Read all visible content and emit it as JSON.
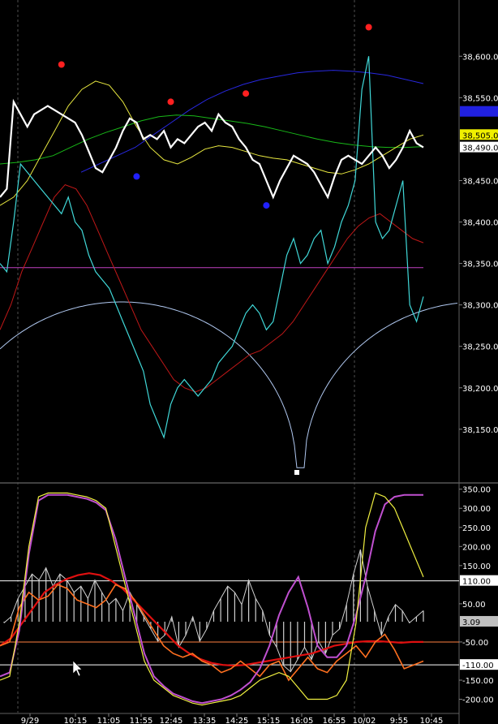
{
  "chart_data": [
    {
      "type": "line",
      "panel": "price",
      "y_ticks": [
        "38,600.0",
        "38,550.0",
        "38,505.0",
        "38,490.0",
        "38,450.0",
        "38,400.0",
        "38,350.0",
        "38,300.0",
        "38,250.0",
        "38,200.0",
        "38,150.0"
      ],
      "y_tick_values": [
        38600,
        38550,
        38505,
        38490,
        38450,
        38400,
        38350,
        38300,
        38250,
        38200,
        38150
      ],
      "ylim": [
        38095,
        38660
      ],
      "grid": false,
      "colors": {
        "price": "#ffffff",
        "cyan": "#40d8d8",
        "red": "#c01818",
        "yellow": "#e8e840",
        "green": "#18b818",
        "blue": "#2828e0",
        "magenta": "#c040c0",
        "arc": "#b0c8f0",
        "dot_red": "#ff2020",
        "dot_blue": "#2020ff"
      },
      "horizontal_line_value": 38345,
      "price_series": [
        38430,
        38440,
        38545,
        38530,
        38515,
        38530,
        38535,
        38540,
        38535,
        38530,
        38525,
        38520,
        38505,
        38485,
        38465,
        38460,
        38475,
        38490,
        38510,
        38525,
        38520,
        38500,
        38505,
        38500,
        38510,
        38490,
        38500,
        38495,
        38505,
        38515,
        38520,
        38510,
        38530,
        38520,
        38515,
        38500,
        38490,
        38475,
        38470,
        38450,
        38430,
        38450,
        38465,
        38480,
        38475,
        38470,
        38460,
        38445,
        38430,
        38455,
        38475,
        38480,
        38475,
        38470,
        38480,
        38490,
        38480,
        38465,
        38475,
        38490,
        38510,
        38495,
        38490
      ],
      "cyan_series": [
        38350,
        38340,
        38400,
        38470,
        38460,
        38450,
        38440,
        38430,
        38420,
        38410,
        38430,
        38400,
        38390,
        38360,
        38340,
        38330,
        38320,
        38300,
        38280,
        38260,
        38240,
        38220,
        38180,
        38160,
        38140,
        38180,
        38200,
        38210,
        38200,
        38190,
        38200,
        38210,
        38230,
        38240,
        38250,
        38270,
        38290,
        38300,
        38290,
        38270,
        38280,
        38320,
        38360,
        38380,
        38350,
        38360,
        38380,
        38390,
        38350,
        38370,
        38400,
        38420,
        38450,
        38560,
        38600,
        38400,
        38380,
        38390,
        38420,
        38450,
        38300,
        38280,
        38310
      ],
      "red_series": [
        38270,
        38300,
        38340,
        38370,
        38400,
        38430,
        38445,
        38440,
        38420,
        38390,
        38360,
        38330,
        38300,
        38270,
        38250,
        38230,
        38210,
        38200,
        38195,
        38200,
        38210,
        38220,
        38230,
        38240,
        38245,
        38255,
        38265,
        38280,
        38300,
        38320,
        38340,
        38360,
        38380,
        38395,
        38405,
        38410,
        38400,
        38390,
        38380,
        38375
      ],
      "yellow_series": [
        38420,
        38430,
        38450,
        38480,
        38510,
        38540,
        38560,
        38570,
        38565,
        38545,
        38515,
        38490,
        38475,
        38470,
        38478,
        38488,
        38492,
        38490,
        38485,
        38480,
        38477,
        38475,
        38470,
        38465,
        38460,
        38458,
        38463,
        38470,
        38480,
        38490,
        38500,
        38505
      ],
      "green_series": [
        38470,
        38472,
        38475,
        38480,
        38490,
        38500,
        38508,
        38515,
        38522,
        38527,
        38529,
        38528,
        38525,
        38522,
        38519,
        38515,
        38510,
        38505,
        38500,
        38496,
        38493,
        38491,
        38490,
        38490,
        38491
      ],
      "blue_series": [
        38460,
        38470,
        38480,
        38490,
        38505,
        38520,
        38535,
        38548,
        38558,
        38566,
        38572,
        38576,
        38580,
        38582,
        38583,
        38582,
        38580,
        38577,
        38572,
        38567
      ],
      "arc_series_note": "reversed arc curve touching the bottom",
      "markers": [
        {
          "color": "red",
          "x_index": 9,
          "value": 38590
        },
        {
          "color": "blue",
          "x_index": 20,
          "value": 38455
        },
        {
          "color": "red",
          "x_index": 25,
          "value": 38545
        },
        {
          "color": "red",
          "x_index": 36,
          "value": 38555
        },
        {
          "color": "blue",
          "x_index": 39,
          "value": 38420
        },
        {
          "color": "red",
          "x_index": 54,
          "value": 38635
        }
      ],
      "box_labels": [
        {
          "text": "38,505.0",
          "value": 38505,
          "bg": "#f0f000",
          "fg": "#000000"
        },
        {
          "text": "38,490.0",
          "value": 38490,
          "bg": "#ffffff",
          "fg": "#000000"
        }
      ]
    },
    {
      "type": "line",
      "panel": "oscillator",
      "y_ticks": [
        "350.00",
        "300.00",
        "250.00",
        "200.00",
        "150.00",
        "110.00",
        "50.00",
        "3.09",
        "-50.00",
        "-110.00",
        "-150.00",
        "-200.00"
      ],
      "y_tick_values": [
        350,
        300,
        250,
        200,
        150,
        110,
        50,
        3.09,
        -50,
        -110,
        -150,
        -200
      ],
      "ylim": [
        -235,
        360
      ],
      "horizontal_lines": [
        {
          "value": 110,
          "color": "#ffffff"
        },
        {
          "value": -50,
          "color": "#ff8040"
        },
        {
          "value": -110,
          "color": "#ffffff"
        }
      ],
      "box_labels": [
        {
          "text": "110.00",
          "value": 110,
          "bg": "#ffffff",
          "fg": "#000000"
        },
        {
          "text": "3.09",
          "value": 3.09,
          "bg": "#c0c0c0",
          "fg": "#000000"
        },
        {
          "text": "-110.00",
          "value": -110,
          "bg": "#ffffff",
          "fg": "#000000"
        }
      ],
      "histogram": [
        0,
        10,
        40,
        60,
        80,
        70,
        90,
        60,
        80,
        70,
        50,
        60,
        40,
        70,
        50,
        30,
        40,
        20,
        50,
        30,
        10,
        -10,
        -30,
        -20,
        10,
        -40,
        -20,
        10,
        -30,
        -10,
        20,
        40,
        60,
        50,
        30,
        70,
        40,
        20,
        -20,
        -40,
        -70,
        -80,
        -60,
        -40,
        -60,
        -30,
        -50,
        -20,
        -10,
        30,
        80,
        120,
        60,
        20,
        -20,
        10,
        30,
        20,
        0,
        10,
        20
      ],
      "stoch_yellow": [
        -150,
        -140,
        0,
        200,
        330,
        340,
        340,
        340,
        335,
        330,
        320,
        300,
        200,
        100,
        0,
        -100,
        -150,
        -170,
        -190,
        -200,
        -210,
        -215,
        -210,
        -205,
        -200,
        -190,
        -170,
        -150,
        -140,
        -130,
        -140,
        -170,
        -200,
        -200,
        -200,
        -190,
        -150,
        0,
        250,
        340,
        330,
        300,
        240,
        180,
        120
      ],
      "stoch_magenta": [
        -140,
        -130,
        -20,
        180,
        320,
        335,
        335,
        335,
        330,
        325,
        315,
        295,
        220,
        120,
        20,
        -80,
        -140,
        -165,
        -185,
        -195,
        -205,
        -210,
        -205,
        -200,
        -190,
        -175,
        -155,
        -120,
        -60,
        20,
        80,
        120,
        40,
        -60,
        -90,
        -90,
        -60,
        20,
        120,
        240,
        310,
        330,
        335,
        335,
        335
      ],
      "orange_series": [
        -60,
        -50,
        40,
        80,
        60,
        70,
        100,
        90,
        60,
        50,
        40,
        60,
        100,
        90,
        60,
        20,
        -20,
        -60,
        -80,
        -90,
        -80,
        -100,
        -110,
        -130,
        -120,
        -100,
        -120,
        -140,
        -110,
        -100,
        -150,
        -120,
        -90,
        -120,
        -130,
        -100,
        -80,
        -60,
        -90,
        -50,
        -30,
        -70,
        -120,
        -110,
        -100
      ],
      "red_osc_series": [
        -60,
        -40,
        0,
        40,
        80,
        100,
        115,
        125,
        130,
        125,
        110,
        90,
        60,
        30,
        0,
        -30,
        -60,
        -80,
        -95,
        -105,
        -110,
        -112,
        -110,
        -105,
        -100,
        -95,
        -90,
        -85,
        -80,
        -70,
        -60,
        -55,
        -50,
        -48,
        -48,
        -50,
        -52,
        -50,
        -50
      ],
      "x_ticks": [
        "9/29",
        "10:15",
        "11:05",
        "11:55",
        "12:45",
        "13:35",
        "14:25",
        "15:15",
        "16:05",
        "16:55",
        "10/02",
        "9:55",
        "10:45"
      ]
    }
  ]
}
